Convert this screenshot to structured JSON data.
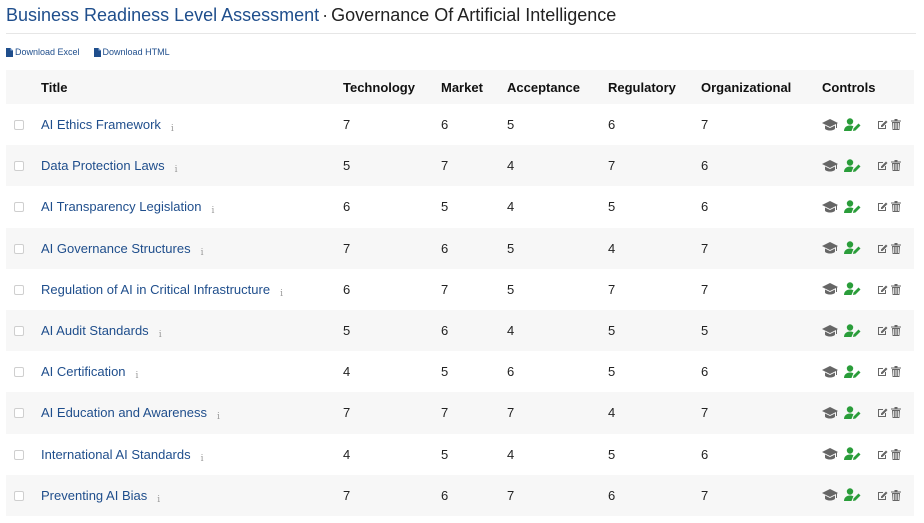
{
  "header": {
    "breadcrumb": "Business Readiness Level Assessment",
    "separator": "·",
    "title": "Governance Of Artificial Intelligence"
  },
  "downloads": {
    "excel_label": "Download Excel",
    "html_label": "Download HTML"
  },
  "columns": {
    "title": "Title",
    "technology": "Technology",
    "market": "Market",
    "acceptance": "Acceptance",
    "regulatory": "Regulatory",
    "organizational": "Organizational",
    "controls": "Controls"
  },
  "info_glyph": "i",
  "colors": {
    "link_blue": "#1f4e8c",
    "control_grey": "#666666",
    "control_green": "#2a9d3a",
    "row_stripe": "#f7f7f7"
  },
  "icons": {
    "download": "file-icon",
    "course": "graduation-cap-icon",
    "assign": "user-edit-icon",
    "edit": "edit-icon",
    "delete": "trash-icon",
    "info": "info-icon"
  },
  "rows": [
    {
      "title": "AI Ethics Framework",
      "technology": "7",
      "market": "6",
      "acceptance": "5",
      "regulatory": "6",
      "organizational": "7"
    },
    {
      "title": "Data Protection Laws",
      "technology": "5",
      "market": "7",
      "acceptance": "4",
      "regulatory": "7",
      "organizational": "6"
    },
    {
      "title": "AI Transparency Legislation",
      "technology": "6",
      "market": "5",
      "acceptance": "4",
      "regulatory": "5",
      "organizational": "6"
    },
    {
      "title": "AI Governance Structures",
      "technology": "7",
      "market": "6",
      "acceptance": "5",
      "regulatory": "4",
      "organizational": "7"
    },
    {
      "title": "Regulation of AI in Critical Infrastructure",
      "technology": "6",
      "market": "7",
      "acceptance": "5",
      "regulatory": "7",
      "organizational": "7"
    },
    {
      "title": "AI Audit Standards",
      "technology": "5",
      "market": "6",
      "acceptance": "4",
      "regulatory": "5",
      "organizational": "5"
    },
    {
      "title": "AI Certification",
      "technology": "4",
      "market": "5",
      "acceptance": "6",
      "regulatory": "5",
      "organizational": "6"
    },
    {
      "title": "AI Education and Awareness",
      "technology": "7",
      "market": "7",
      "acceptance": "7",
      "regulatory": "4",
      "organizational": "7"
    },
    {
      "title": "International AI Standards",
      "technology": "4",
      "market": "5",
      "acceptance": "4",
      "regulatory": "5",
      "organizational": "6"
    },
    {
      "title": "Preventing AI Bias",
      "technology": "7",
      "market": "6",
      "acceptance": "7",
      "regulatory": "6",
      "organizational": "7"
    }
  ]
}
